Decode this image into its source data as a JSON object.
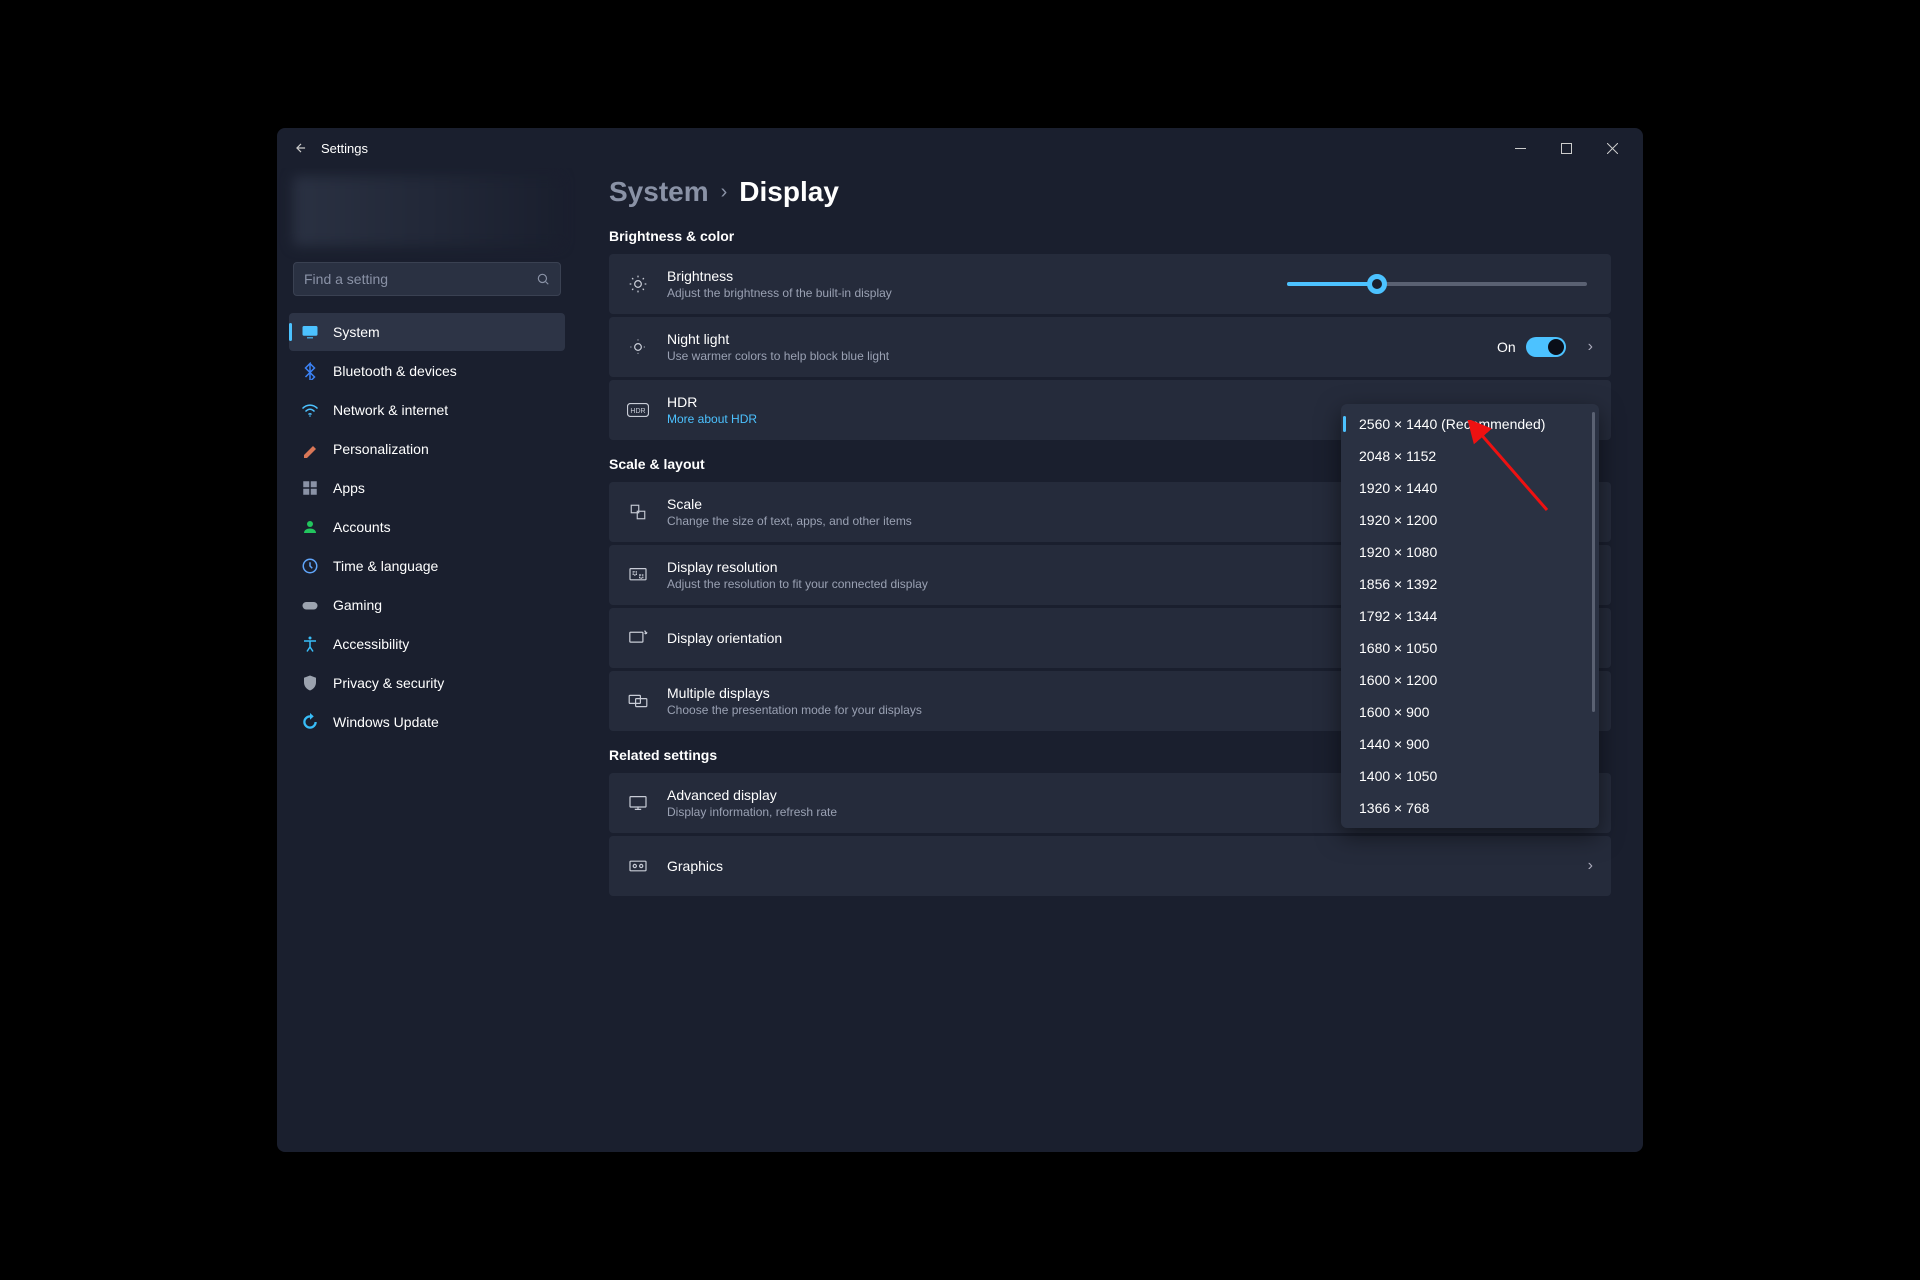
{
  "titlebar": {
    "title": "Settings"
  },
  "search": {
    "placeholder": "Find a setting"
  },
  "nav": {
    "items": [
      {
        "label": "System",
        "icon": "display",
        "color": "#4cc2ff",
        "active": true
      },
      {
        "label": "Bluetooth & devices",
        "icon": "bluetooth",
        "color": "#3b82f6"
      },
      {
        "label": "Network & internet",
        "icon": "wifi",
        "color": "#4cc2ff"
      },
      {
        "label": "Personalization",
        "icon": "brush",
        "color": "#d97757"
      },
      {
        "label": "Apps",
        "icon": "apps",
        "color": "#8a92a6"
      },
      {
        "label": "Accounts",
        "icon": "person",
        "color": "#22c55e"
      },
      {
        "label": "Time & language",
        "icon": "clock",
        "color": "#60a5fa"
      },
      {
        "label": "Gaming",
        "icon": "gamepad",
        "color": "#9ca3af"
      },
      {
        "label": "Accessibility",
        "icon": "accessibility",
        "color": "#38bdf8"
      },
      {
        "label": "Privacy & security",
        "icon": "shield",
        "color": "#9ca3af"
      },
      {
        "label": "Windows Update",
        "icon": "update",
        "color": "#38bdf8"
      }
    ]
  },
  "breadcrumb": {
    "parent": "System",
    "current": "Display"
  },
  "sections": {
    "brightness": {
      "title": "Brightness & color",
      "brightness_title": "Brightness",
      "brightness_sub": "Adjust the brightness of the built-in display",
      "nightlight_title": "Night light",
      "nightlight_sub": "Use warmer colors to help block blue light",
      "nightlight_state": "On",
      "hdr_title": "HDR",
      "hdr_link": "More about HDR"
    },
    "scale": {
      "title": "Scale & layout",
      "scale_title": "Scale",
      "scale_sub": "Change the size of text, apps, and other items",
      "resolution_title": "Display resolution",
      "resolution_sub": "Adjust the resolution to fit your connected display",
      "orientation_title": "Display orientation",
      "multiple_title": "Multiple displays",
      "multiple_sub": "Choose the presentation mode for your displays"
    },
    "related": {
      "title": "Related settings",
      "advanced_title": "Advanced display",
      "advanced_sub": "Display information, refresh rate",
      "graphics_title": "Graphics"
    }
  },
  "resolution_dropdown": {
    "options": [
      "2560 × 1440 (Recommended)",
      "2048 × 1152",
      "1920 × 1440",
      "1920 × 1200",
      "1920 × 1080",
      "1856 × 1392",
      "1792 × 1344",
      "1680 × 1050",
      "1600 × 1200",
      "1600 × 900",
      "1440 × 900",
      "1400 × 1050",
      "1366 × 768"
    ],
    "selected_index": 0
  }
}
